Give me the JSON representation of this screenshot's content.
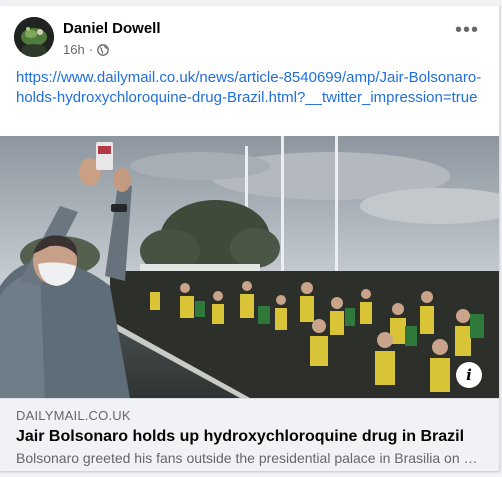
{
  "post": {
    "author": "Daniel Dowell",
    "time": "16h",
    "separator": "·",
    "privacy_icon": "globe-icon",
    "more_icon": "more-horizontal-icon",
    "more_label": "•••",
    "text": "https://www.dailymail.co.uk/news/article-8540699/amp/Jair-Bolsonaro-holds-hydroxychloroquine-drug-Brazil.html?__twitter_impression=true"
  },
  "link_preview": {
    "domain": "DAILYMAIL.CO.UK",
    "title": "Jair Bolsonaro holds up hydroxychloroquine drug in Brazil",
    "description": "Bolsonaro greeted his fans outside the presidential palace in Brasilia on Friday",
    "info_icon": "info-icon",
    "info_label": "i"
  },
  "colors": {
    "link": "#216fdb",
    "secondary_text": "#65676b",
    "preview_background": "#f0f2f5"
  }
}
